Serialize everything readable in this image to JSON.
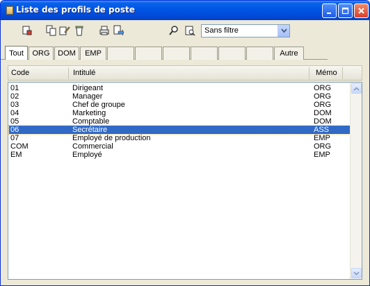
{
  "window": {
    "title": "Liste des profils de poste"
  },
  "filter": {
    "value": "Sans filtre"
  },
  "tabs": [
    "Tout",
    "ORG",
    "DOM",
    "EMP",
    "",
    "",
    "",
    "",
    "",
    "",
    "Autre"
  ],
  "columns": {
    "code": "Code",
    "label": "Intitulé",
    "memo": "Mémo"
  },
  "rows": [
    {
      "code": "01",
      "label": "Dirigeant",
      "memo": "ORG"
    },
    {
      "code": "02",
      "label": "Manager",
      "memo": "ORG"
    },
    {
      "code": "03",
      "label": "Chef de groupe",
      "memo": "ORG"
    },
    {
      "code": "04",
      "label": "Marketing",
      "memo": "DOM"
    },
    {
      "code": "05",
      "label": "Comptable",
      "memo": "DOM"
    },
    {
      "code": "06",
      "label": "Secrétaire",
      "memo": "ASS"
    },
    {
      "code": "07",
      "label": "Employé de production",
      "memo": "EMP"
    },
    {
      "code": "COM",
      "label": "Commercial",
      "memo": "ORG"
    },
    {
      "code": "EM",
      "label": "Employé",
      "memo": "EMP"
    }
  ],
  "selected_row": "06",
  "colors": {
    "title_bar": "#0055e5",
    "selection": "#316ac5",
    "window_bg": "#ece9d8"
  },
  "icons": {
    "title": "window-icon",
    "toolbar": [
      "new-profile-icon",
      "duplicate-icon",
      "edit-icon",
      "delete-icon",
      "print-icon",
      "export-icon",
      "search-icon",
      "filter-icon"
    ],
    "title_buttons": [
      "minimize-icon",
      "maximize-icon",
      "close-icon"
    ]
  }
}
